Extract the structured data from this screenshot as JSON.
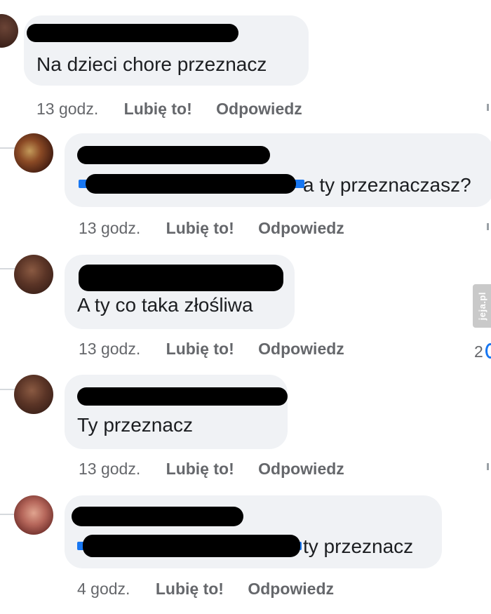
{
  "comments": [
    {
      "text": "Na dzieci chore przeznacz",
      "time": "13 godz.",
      "like": "Lubię to!",
      "reply": "Odpowiedz"
    },
    {
      "text": "a ty przeznaczasz?",
      "time": "13 godz.",
      "like": "Lubię to!",
      "reply": "Odpowiedz"
    },
    {
      "text": "A ty co taka złośliwa",
      "time": "13 godz.",
      "like": "Lubię to!",
      "reply": "Odpowiedz"
    },
    {
      "text": "Ty przeznacz",
      "time": "13 godz.",
      "like": "Lubię to!",
      "reply": "Odpowiedz"
    },
    {
      "text": "ty przeznacz",
      "time": "4 godz.",
      "like": "Lubię to!",
      "reply": "Odpowiedz"
    }
  ],
  "side": {
    "count": "2"
  },
  "watermark": "jeja.pl",
  "colors": {
    "bubble": "#f0f2f5",
    "meta": "#65676b",
    "link": "#1877f2"
  }
}
